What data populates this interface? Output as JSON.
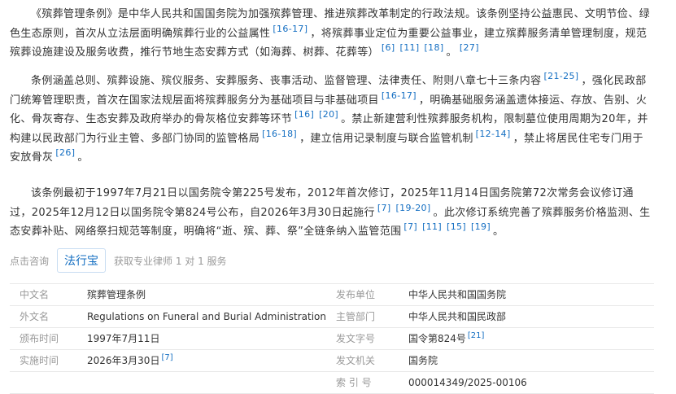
{
  "paragraphs": {
    "p1": {
      "t1": "《殡葬管理条例》是中华人民共和国国务院为加强殡葬管理、推进殡葬改革制定的行政法规。该条例坚持公益惠民、文明节俭、绿色生态原则，首次从立法层面明确殡葬行业的公益属性",
      "r1": "[16-17]",
      "t2": "，将殡葬事业定位为重要公益事业，建立殡葬服务清单管理制度，规范殡葬设施建设及服务收费，推行节地生态安葬方式（如海葬、树葬、花葬等）",
      "r2": "[6]",
      "r3": "[11]",
      "r4": "[18]",
      "t3": "。",
      "r5": "[27]"
    },
    "p2": {
      "t1": "条例涵盖总则、殡葬设施、殡仪服务、安葬服务、丧事活动、监督管理、法律责任、附则八章七十三条内容",
      "r1": "[21-25]",
      "t2": "，强化民政部门统筹管理职责，首次在国家法规层面将殡葬服务分为基础项目与非基础项目",
      "r2": "[16-17]",
      "t3": "，明确基础服务涵盖遗体接运、存放、告别、火化、骨灰寄存、生态安葬及政府举办的骨灰格位安葬等环节",
      "r3": "[16]",
      "r4": "[20]",
      "t4": "。禁止新建营利性殡葬服务机构，限制墓位使用周期为20年，并构建以民政部门为行业主管、多部门协同的监管格局",
      "r5": "[16-18]",
      "t5": "，建立信用记录制度与联合监管机制",
      "r6": "[12-14]",
      "t6": "，禁止将居民住宅专门用于安放骨灰",
      "r7": "[26]",
      "t7": "。"
    },
    "p3": {
      "t1": "该条例最初于1997年7月21日以国务院令第225号发布，2012年首次修订，2025年11月14日国务院第72次常务会议修订通过，2025年12月12日以国务院令第824号公布，自2026年3月30日起施行",
      "r1": "[7]",
      "r2": "[19-20]",
      "t2": "。此次修订系统完善了殡葬服务价格监测、生态安葬补贴、网络祭扫规范等制度，明确将“逝、殡、葬、祭”全链条纳入监管范围",
      "r3": "[7]",
      "r4": "[11]",
      "r5": "[15]",
      "r6": "[19]",
      "t3": "。"
    }
  },
  "consult": {
    "label": "点击咨询",
    "button": "法行宝",
    "service": "获取专业律师 1 对 1 服务"
  },
  "info": {
    "rows": [
      {
        "l_label": "中文名",
        "l_value": "殡葬管理条例",
        "l_ref": "",
        "r_label": "发布单位",
        "r_value": "中华人民共和国国务院",
        "r_ref": ""
      },
      {
        "l_label": "外文名",
        "l_value": "Regulations on Funeral and Burial Administration",
        "l_ref": "",
        "r_label": "主管部门",
        "r_value": "中华人民共和国民政部",
        "r_ref": ""
      },
      {
        "l_label": "颁布时间",
        "l_value": "1997年7月11日",
        "l_ref": "",
        "r_label": "发文字号",
        "r_value": "国令第824号",
        "r_ref": "[21]"
      },
      {
        "l_label": "实施时间",
        "l_value": "2026年3月30日",
        "l_ref": "[7]",
        "r_label": "发文机关",
        "r_value": "国务院",
        "r_ref": ""
      },
      {
        "l_label": "",
        "l_value": "",
        "l_ref": "",
        "r_label": "索 引 号",
        "r_value": "000014349/2025-00106",
        "r_ref": ""
      }
    ]
  },
  "colors": {
    "link": "#136ec2",
    "label": "#999999",
    "text": "#333333",
    "border": "#e8e8e8"
  }
}
